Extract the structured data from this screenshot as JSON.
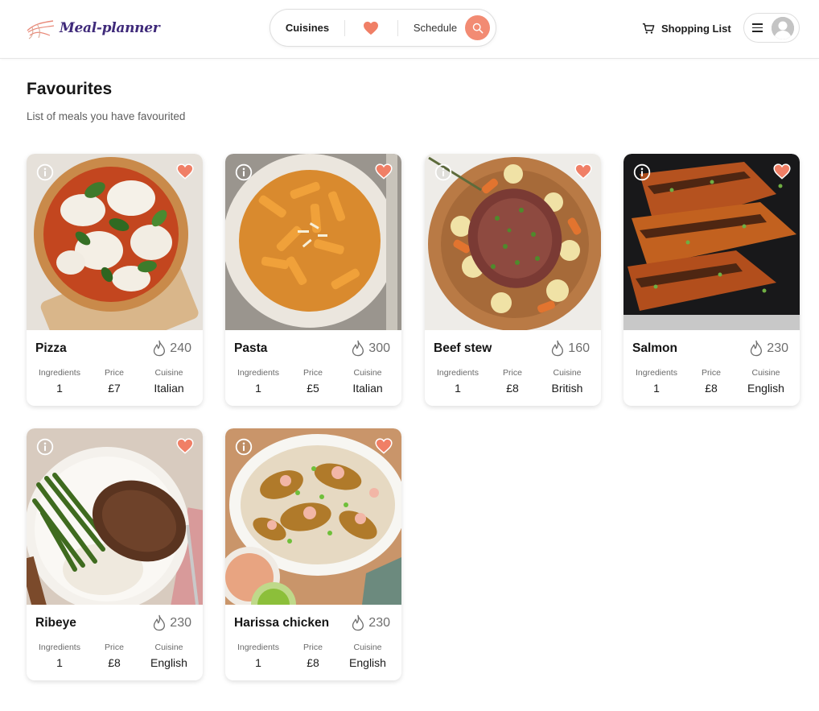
{
  "header": {
    "logo_text": "Meal-planner",
    "nav": {
      "cuisines_label": "Cuisines",
      "schedule_label": "Schedule"
    },
    "shopping_list_label": "Shopping List"
  },
  "colors": {
    "accent": "#f28b73",
    "logo": "#3f2a7a",
    "heart": "#f07f66"
  },
  "page": {
    "title": "Favourites",
    "subtitle": "List of meals you have favourited"
  },
  "stat_labels": {
    "ingredients": "Ingredients",
    "price": "Price",
    "cuisine": "Cuisine"
  },
  "meals": [
    {
      "name": "Pizza",
      "calories": "240",
      "ingredients": "1",
      "price": "£7",
      "cuisine": "Italian",
      "favourited": true,
      "icons": [
        "info-icon",
        "heart-icon",
        "flame-icon"
      ]
    },
    {
      "name": "Pasta",
      "calories": "300",
      "ingredients": "1",
      "price": "£5",
      "cuisine": "Italian",
      "favourited": true,
      "icons": [
        "info-icon",
        "heart-icon",
        "flame-icon"
      ]
    },
    {
      "name": "Beef stew",
      "calories": "160",
      "ingredients": "1",
      "price": "£8",
      "cuisine": "British",
      "favourited": true,
      "icons": [
        "info-icon",
        "heart-icon",
        "flame-icon"
      ]
    },
    {
      "name": "Salmon",
      "calories": "230",
      "ingredients": "1",
      "price": "£8",
      "cuisine": "English",
      "favourited": true,
      "icons": [
        "info-icon",
        "heart-icon",
        "flame-icon"
      ]
    },
    {
      "name": "Ribeye",
      "calories": "230",
      "ingredients": "1",
      "price": "£8",
      "cuisine": "English",
      "favourited": true,
      "icons": [
        "info-icon",
        "heart-icon",
        "flame-icon"
      ]
    },
    {
      "name": "Harissa chicken",
      "calories": "230",
      "ingredients": "1",
      "price": "£8",
      "cuisine": "English",
      "favourited": true,
      "icons": [
        "info-icon",
        "heart-icon",
        "flame-icon"
      ]
    }
  ]
}
